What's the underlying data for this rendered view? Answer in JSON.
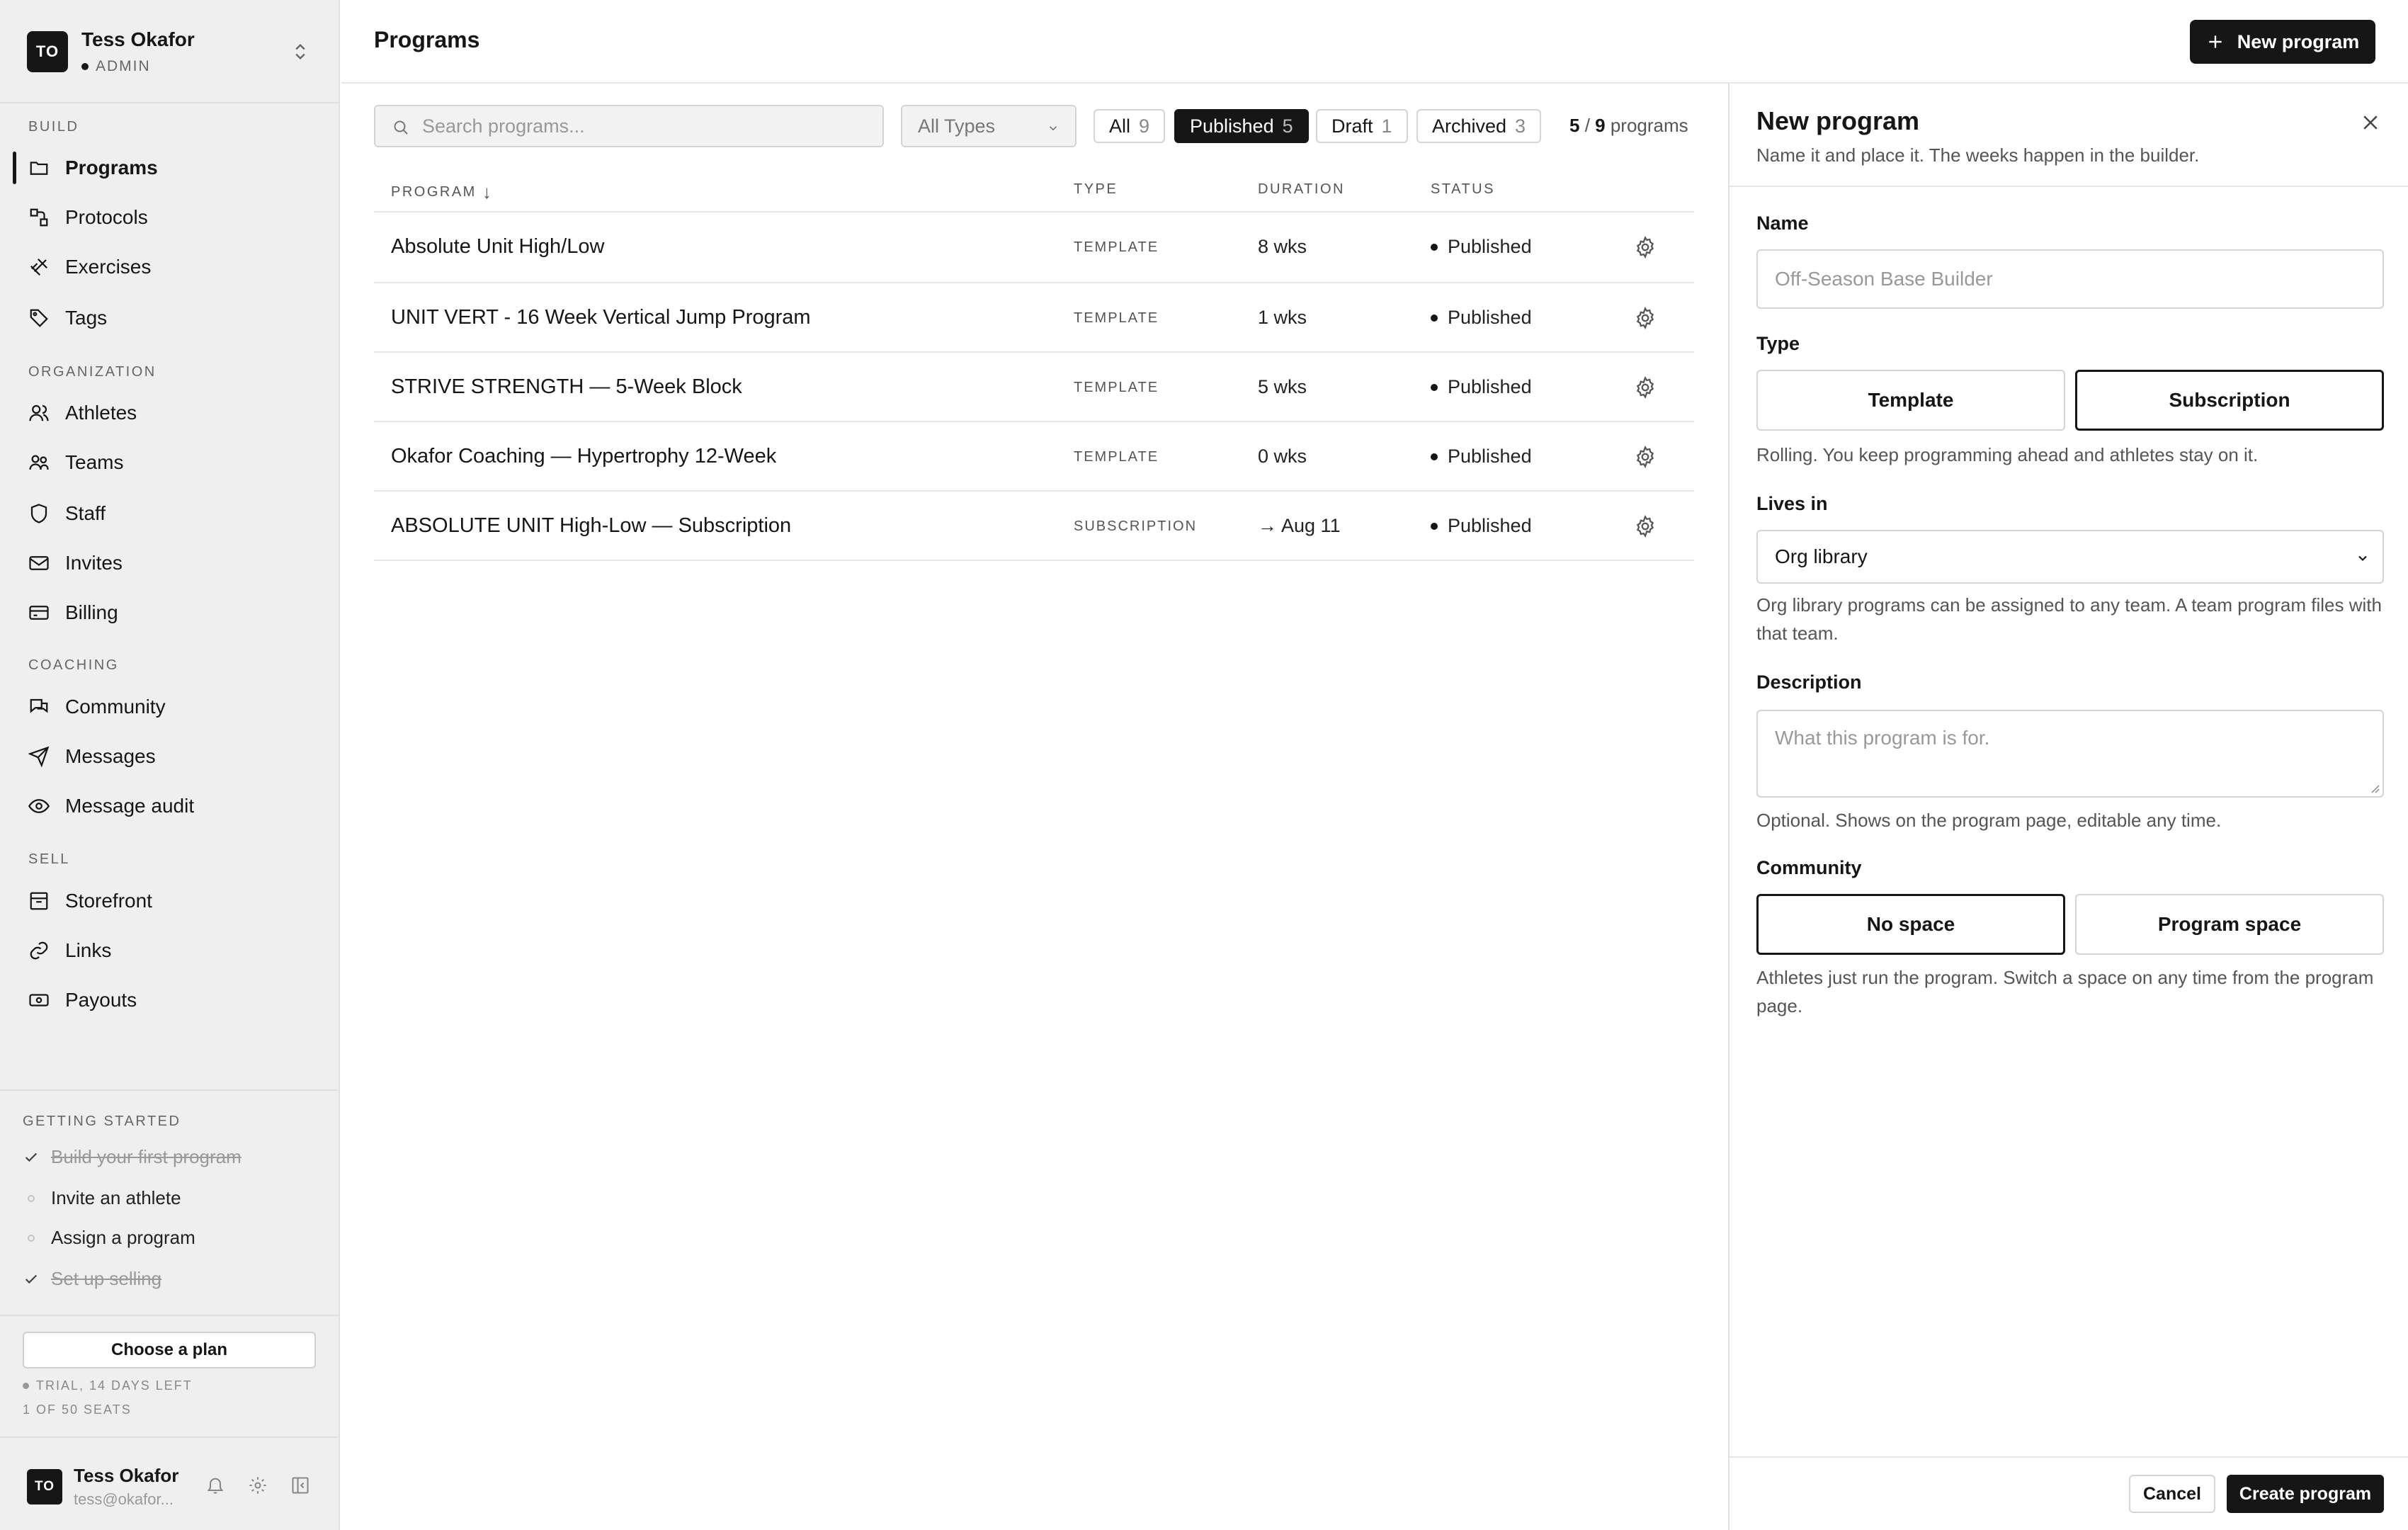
{
  "account": {
    "initials": "TO",
    "name": "Tess Okafor",
    "role": "ADMIN"
  },
  "nav": {
    "sections": [
      "BUILD",
      "ORGANIZATION",
      "COACHING",
      "SELL"
    ],
    "items": [
      {
        "label": "Programs",
        "icon": "folder-icon"
      },
      {
        "label": "Protocols",
        "icon": "protocol-icon"
      },
      {
        "label": "Exercises",
        "icon": "dumbbell-icon"
      },
      {
        "label": "Tags",
        "icon": "tag-icon"
      },
      {
        "label": "Athletes",
        "icon": "users-icon"
      },
      {
        "label": "Teams",
        "icon": "team-icon"
      },
      {
        "label": "Staff",
        "icon": "shield-icon"
      },
      {
        "label": "Invites",
        "icon": "mail-icon"
      },
      {
        "label": "Billing",
        "icon": "card-icon"
      },
      {
        "label": "Community",
        "icon": "chat-icon"
      },
      {
        "label": "Messages",
        "icon": "send-icon"
      },
      {
        "label": "Message audit",
        "icon": "eye-icon"
      },
      {
        "label": "Storefront",
        "icon": "store-icon"
      },
      {
        "label": "Links",
        "icon": "link-icon"
      },
      {
        "label": "Payouts",
        "icon": "cash-icon"
      }
    ]
  },
  "getting_started": {
    "title": "GETTING STARTED",
    "items": [
      {
        "label": "Build your first program",
        "done": true
      },
      {
        "label": "Invite an athlete",
        "done": false
      },
      {
        "label": "Assign a program",
        "done": false
      },
      {
        "label": "Set up selling",
        "done": true
      }
    ]
  },
  "plan": {
    "button": "Choose a plan",
    "trial": "TRIAL, 14 DAYS LEFT",
    "seats": "1 OF 50 SEATS"
  },
  "user": {
    "initials": "TO",
    "name": "Tess Okafor",
    "email": "tess@okafor..."
  },
  "header": {
    "title": "Programs",
    "new_button": "New program"
  },
  "toolbar": {
    "search_placeholder": "Search programs...",
    "type_filter": "All Types",
    "filters": [
      {
        "label": "All",
        "count": "9",
        "active": false
      },
      {
        "label": "Published",
        "count": "5",
        "active": true
      },
      {
        "label": "Draft",
        "count": "1",
        "active": false
      },
      {
        "label": "Archived",
        "count": "3",
        "active": false
      }
    ],
    "count_shown": "5",
    "count_sep": " / ",
    "count_total": "9",
    "count_suffix": " programs"
  },
  "table": {
    "columns": {
      "program": "PROGRAM",
      "sort_arrow": "↓",
      "type": "TYPE",
      "duration": "DURATION",
      "status": "STATUS"
    },
    "rows": [
      {
        "name": "Absolute Unit High/Low",
        "type": "TEMPLATE",
        "duration": "8 wks",
        "status": "Published"
      },
      {
        "name": "UNIT VERT - 16 Week Vertical Jump Program",
        "type": "TEMPLATE",
        "duration": "1 wks",
        "status": "Published"
      },
      {
        "name": "STRIVE STRENGTH — 5-Week Block",
        "type": "TEMPLATE",
        "duration": "5 wks",
        "status": "Published"
      },
      {
        "name": "Okafor Coaching — Hypertrophy 12-Week",
        "type": "TEMPLATE",
        "duration": "0 wks",
        "status": "Published"
      },
      {
        "name": "ABSOLUTE UNIT High-Low — Subscription",
        "type": "SUBSCRIPTION",
        "duration": "→ Aug 11",
        "status": "Published"
      }
    ]
  },
  "panel": {
    "title": "New program",
    "subtitle": "Name it and place it. The weeks happen in the builder.",
    "name_label": "Name",
    "name_placeholder": "Off-Season Base Builder",
    "type_label": "Type",
    "type_options": [
      "Template",
      "Subscription"
    ],
    "type_selected": "Subscription",
    "type_help": "Rolling. You keep programming ahead and athletes stay on it.",
    "lives_label": "Lives in",
    "lives_value": "Org library",
    "lives_help": "Org library programs can be assigned to any team. A team program files with that team.",
    "desc_label": "Description",
    "desc_placeholder": "What this program is for.",
    "desc_help": "Optional. Shows on the program page, editable any time.",
    "community_label": "Community",
    "community_options": [
      "No space",
      "Program space"
    ],
    "community_selected": "No space",
    "community_help": "Athletes just run the program. Switch a space on any time from the program page.",
    "cancel": "Cancel",
    "create": "Create program"
  },
  "colors": {
    "accent": "#161616",
    "sidebar_bg": "#efefef",
    "border": "#d4d4d4",
    "muted_text": "#555555"
  }
}
